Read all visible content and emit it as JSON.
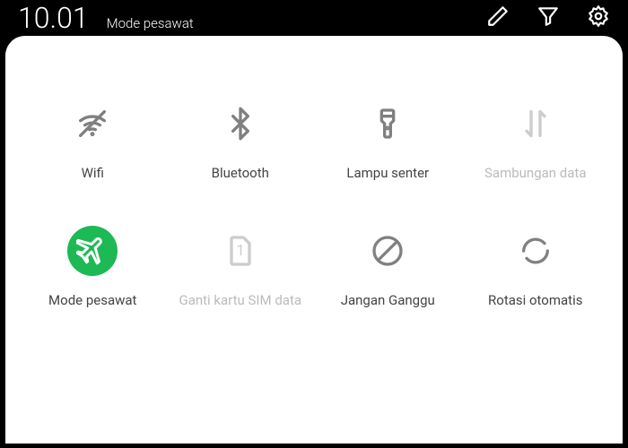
{
  "status": {
    "clock": "10.01",
    "mode_text": "Mode pesawat"
  },
  "tiles": {
    "wifi": {
      "label": "Wifi"
    },
    "bluetooth": {
      "label": "Bluetooth"
    },
    "flashlight": {
      "label": "Lampu senter"
    },
    "data": {
      "label": "Sambungan data"
    },
    "airplane": {
      "label": "Mode pesawat"
    },
    "sim": {
      "label": "Ganti kartu SIM data"
    },
    "dnd": {
      "label": "Jangan Ganggu"
    },
    "rotation": {
      "label": "Rotasi otomatis"
    }
  },
  "colors": {
    "active": "#1db954"
  }
}
